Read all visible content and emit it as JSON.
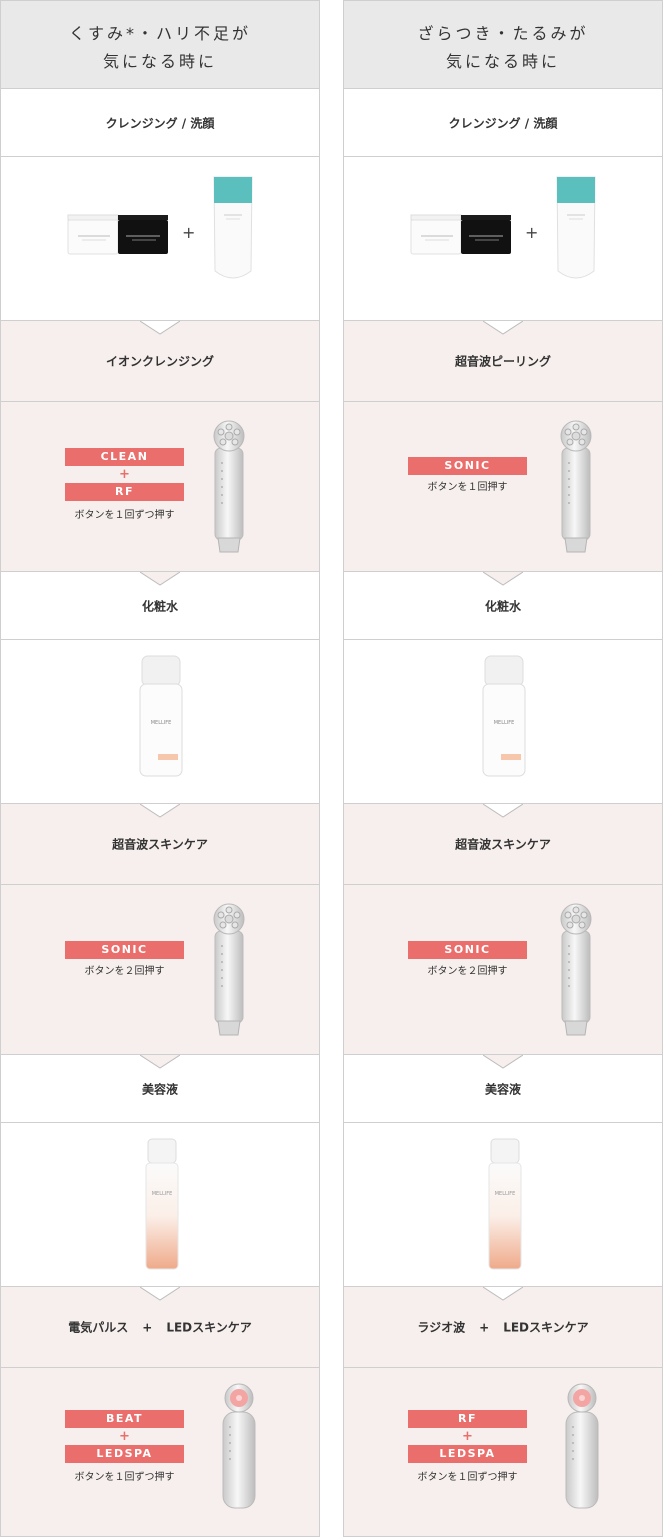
{
  "columns": [
    {
      "title": "くすみ*・ハリ不足が\n気になる時に",
      "cleanse_label": "クレンジング / 洗顔",
      "plus": "+",
      "step1": {
        "label": "イオンクレンジング",
        "badges": [
          "CLEAN",
          "RF"
        ],
        "note": "ボタンを１回ずつ押す"
      },
      "lotion_label": "化粧水",
      "step2": {
        "label": "超音波スキンケア",
        "badges": [
          "SONIC"
        ],
        "note": "ボタンを２回押す"
      },
      "serum_label": "美容液",
      "step3": {
        "label_a": "電気パルス",
        "label_plus": "+",
        "label_b": "LEDスキンケア",
        "badges": [
          "BEAT",
          "LEDSPA"
        ],
        "note": "ボタンを１回ずつ押す"
      }
    },
    {
      "title": "ざらつき・たるみが\n気になる時に",
      "cleanse_label": "クレンジング / 洗顔",
      "plus": "+",
      "step1": {
        "label": "超音波ピーリング",
        "badges": [
          "SONIC"
        ],
        "note": "ボタンを１回押す"
      },
      "lotion_label": "化粧水",
      "step2": {
        "label": "超音波スキンケア",
        "badges": [
          "SONIC"
        ],
        "note": "ボタンを２回押す"
      },
      "serum_label": "美容液",
      "step3": {
        "label_a": "ラジオ波",
        "label_plus": "+",
        "label_b": "LEDスキンケア",
        "badges": [
          "RF",
          "LEDSPA"
        ],
        "note": "ボタンを１回ずつ押す"
      }
    }
  ],
  "product_text": {
    "balm_label": "BALM CLEANSE",
    "brand": "MELLIFE"
  },
  "colors": {
    "accent": "#ea6f6c",
    "pink_bg": "#f7efed",
    "header_bg": "#e9e9e9",
    "border": "#cfcfcf",
    "led_pink": "#f3a5a4",
    "tube_teal": "#5bbfbd"
  }
}
